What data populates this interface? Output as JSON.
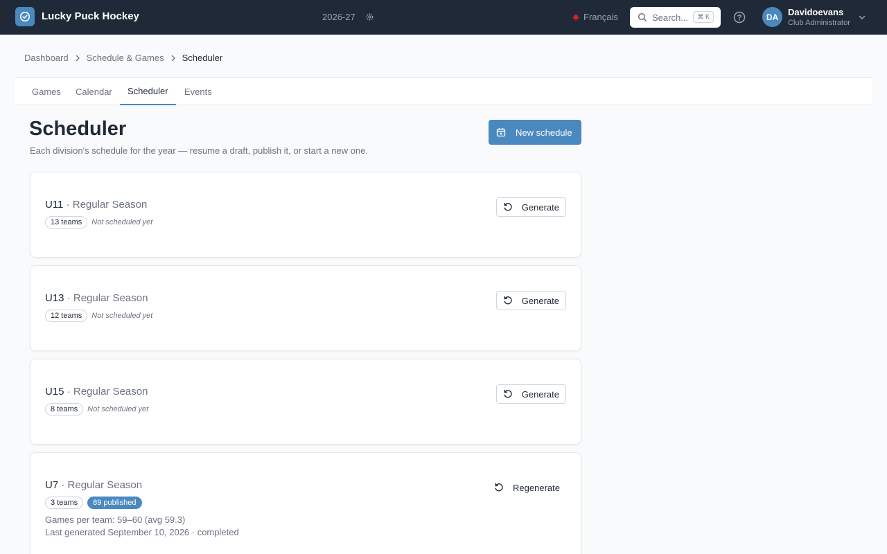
{
  "header": {
    "app_title": "Lucky Puck Hockey",
    "season": "2026-27",
    "language": "Français",
    "search_label": "Search...",
    "search_shortcut": "⌘ K",
    "user_initials": "DA",
    "user_name": "Davidoevans",
    "user_role": "Club Administrator"
  },
  "breadcrumb": [
    "Dashboard",
    "Schedule & Games",
    "Scheduler"
  ],
  "tabs": [
    "Games",
    "Calendar",
    "Scheduler",
    "Events"
  ],
  "active_tab": "Scheduler",
  "page": {
    "title": "Scheduler",
    "subtitle": "Each division's schedule for the year — resume a draft, publish it, or start a new one.",
    "new_button": "New schedule"
  },
  "cards": [
    {
      "division": "U11",
      "separator": "·",
      "season": "Regular Season",
      "teams": "13 teams",
      "status": "Not scheduled yet",
      "action": "Generate"
    },
    {
      "division": "U13",
      "separator": "·",
      "season": "Regular Season",
      "teams": "12 teams",
      "status": "Not scheduled yet",
      "action": "Generate"
    },
    {
      "division": "U15",
      "separator": "·",
      "season": "Regular Season",
      "teams": "8 teams",
      "status": "Not scheduled yet",
      "action": "Generate"
    },
    {
      "division": "U7",
      "separator": "·",
      "season": "Regular Season",
      "teams": "3 teams",
      "published": "89 published",
      "games_per_team": "Games per team: 59–60 (avg 59.3)",
      "last_generated": "Last generated September 10, 2026 · completed",
      "action": "Regenerate"
    }
  ],
  "colors": {
    "topbar": "#1f2937",
    "accent": "#4a88c0",
    "background": "#f9fafb"
  },
  "icons": {
    "logo": "check-circle-icon",
    "settings": "gear-icon",
    "flag": "maple-leaf-icon",
    "search": "search-icon",
    "help": "help-circle-icon",
    "chevron": "chevron-down-icon",
    "calendar": "calendar-plus-icon",
    "generate": "refresh-icon"
  }
}
